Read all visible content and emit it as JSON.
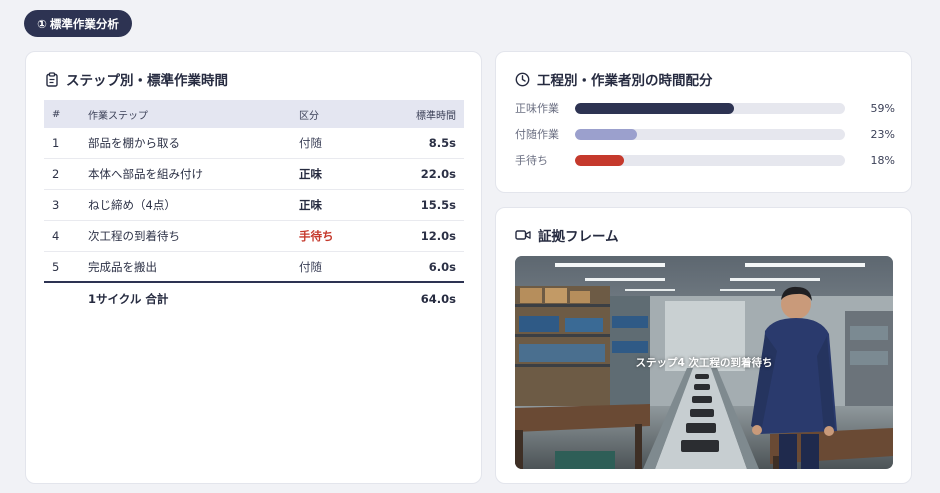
{
  "badge": {
    "number": "①",
    "label": "標準作業分析"
  },
  "steps_card": {
    "title": "ステップ別・標準作業時間",
    "headers": {
      "no": "#",
      "step": "作業ステップ",
      "kind": "区分",
      "time": "標準時間"
    },
    "rows": [
      {
        "no": "1",
        "step": "部品を棚から取る",
        "kind": "付随",
        "time": "8.5s"
      },
      {
        "no": "2",
        "step": "本体へ部品を組み付け",
        "kind": "正味",
        "time": "22.0s"
      },
      {
        "no": "3",
        "step": "ねじ締め（4点）",
        "kind": "正味",
        "time": "15.5s"
      },
      {
        "no": "4",
        "step": "次工程の到着待ち",
        "kind": "手待ち",
        "time": "12.0s"
      },
      {
        "no": "5",
        "step": "完成品を搬出",
        "kind": "付随",
        "time": "6.0s"
      }
    ],
    "total": {
      "label": "1サイクル 合計",
      "time": "64.0s"
    }
  },
  "dist_card": {
    "title": "工程別・作業者別の時間配分",
    "bars": [
      {
        "label": "正味作業",
        "percent": 59,
        "percent_text": "59%",
        "color": "#2d3352"
      },
      {
        "label": "付随作業",
        "percent": 23,
        "percent_text": "23%",
        "color": "#9ba0cd"
      },
      {
        "label": "手待ち",
        "percent": 18,
        "percent_text": "18%",
        "color": "#c5392c"
      }
    ]
  },
  "evidence_card": {
    "title": "証拠フレーム",
    "caption": "ステップ4 次工程の到着待ち"
  }
}
